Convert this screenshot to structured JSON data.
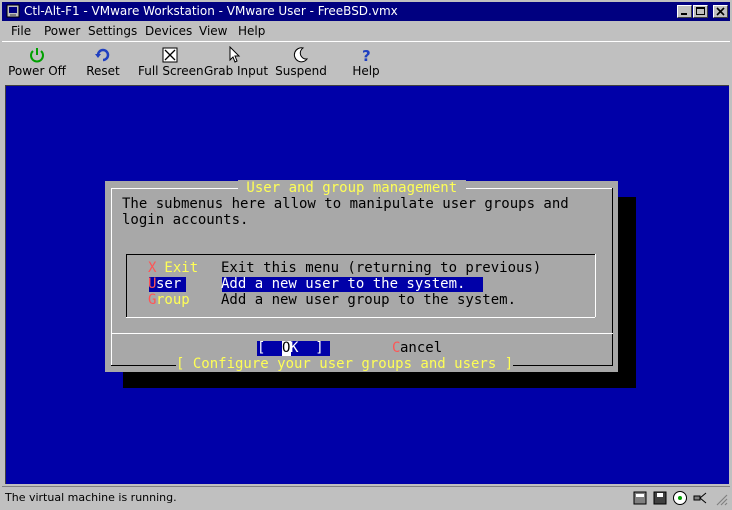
{
  "window": {
    "title": "Ctl-Alt-F1 - VMware Workstation - VMware User - FreeBSD.vmx"
  },
  "menubar": {
    "items": [
      "File",
      "Power",
      "Settings",
      "Devices",
      "View",
      "Help"
    ]
  },
  "toolbar": {
    "power_off": "Power Off",
    "reset": "Reset",
    "full_screen": "Full Screen",
    "grab_input": "Grab Input",
    "suspend": "Suspend",
    "help": "Help"
  },
  "dialog": {
    "title": " User and group management ",
    "description_line1": "The submenus here allow to manipulate user groups and",
    "description_line2": "login accounts.",
    "items": [
      {
        "hotkey": "X",
        "rest": " Exit",
        "description": "Exit this menu (returning to previous)"
      },
      {
        "hotkey": "U",
        "rest": "ser",
        "description": "Add a new user to the system."
      },
      {
        "hotkey": "G",
        "rest": "roup",
        "description": "Add a new user group to the system."
      }
    ],
    "ok_open": "[  ",
    "ok_hot": "O",
    "ok_rest": "K  ]",
    "cancel_hot": "C",
    "cancel_rest": "ancel",
    "footer": "[ Configure your user groups and users ]"
  },
  "statusbar": {
    "text": "The virtual machine is running."
  },
  "colors": {
    "console_bg": "#0000a8",
    "dialog_bg": "#a8a8a8",
    "highlight": "#0000a8",
    "title_yellow": "#ffff55",
    "hotkey_red": "#ff5555",
    "titlebar": "#000080"
  },
  "icons": [
    "power-icon",
    "reset-icon",
    "full-screen-icon",
    "grab-input-icon",
    "suspend-icon",
    "help-icon"
  ]
}
